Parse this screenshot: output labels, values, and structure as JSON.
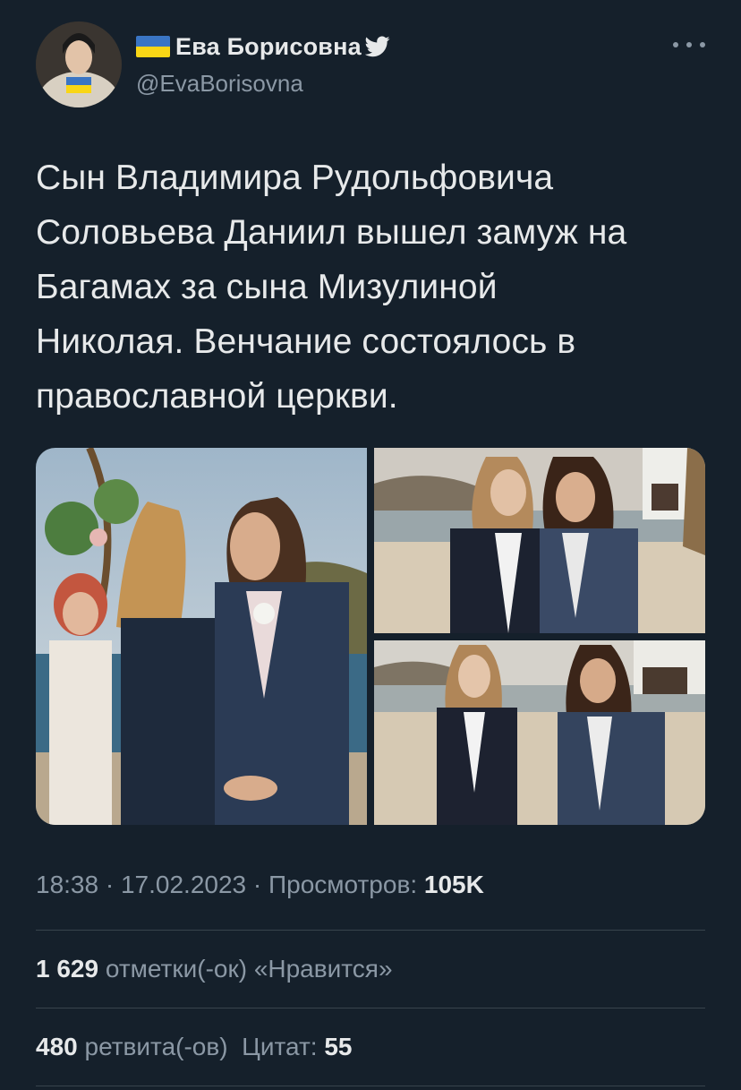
{
  "header": {
    "flag_icon": "ukraine-flag-icon",
    "display_name": "Ева Борисовна",
    "verified_icon": "twitter-bird-icon",
    "handle": "@EvaBorisovna",
    "more_icon": "more-horizontal-icon"
  },
  "tweet": {
    "lines": [
      "Сын Владимира Рудольфовича",
      "Соловьева Даниил вышел замуж на",
      "Багамах за сына Мизулиной",
      "Николая. Венчание состоялось в",
      "православной церкви."
    ]
  },
  "media": {
    "photos": [
      {
        "name": "wedding-kiss-photo"
      },
      {
        "name": "beach-couple-photo"
      },
      {
        "name": "beach-walk-photo"
      }
    ]
  },
  "meta": {
    "time": "18:38",
    "sep1": " · ",
    "date": "17.02.2023",
    "sep2": " · ",
    "views_label": "Просмотров: ",
    "views_value": "105K"
  },
  "stats": {
    "likes_count": "1 629",
    "likes_label": " отметки(-ок) «Нравится»",
    "retweets_count": "480",
    "retweets_label": " ретвита(-ов)",
    "quotes_label": "  Цитат: ",
    "quotes_count": "55"
  },
  "colors": {
    "background": "#15202b",
    "text": "#e7e9ea",
    "secondary": "#8b98a5",
    "divider": "#38444d"
  }
}
